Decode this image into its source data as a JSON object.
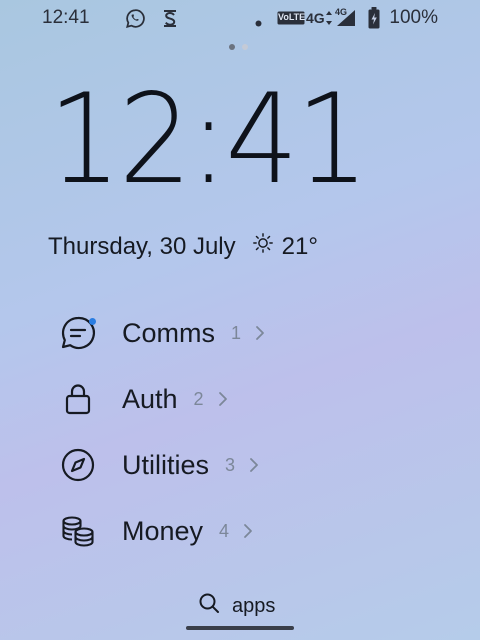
{
  "status_bar": {
    "time": "12:41",
    "network_badge": "VoLTE",
    "network_type": "4G",
    "network_type_secondary": "4G",
    "battery_percent": "100%",
    "icons": [
      "whatsapp-icon",
      "sync-icon",
      "notification-dot-icon",
      "volte-icon",
      "signal-icon",
      "battery-charging-icon"
    ]
  },
  "pager": {
    "pages": 2,
    "active_page": 1
  },
  "lock_clock": {
    "time": "12:41",
    "date": "Thursday, 30 July",
    "weather_icon": "sun-icon",
    "temperature": "21°"
  },
  "groups": [
    {
      "label": "Comms",
      "count": "1",
      "icon": "chat-bubble-icon",
      "has_notification": true
    },
    {
      "label": "Auth",
      "count": "2",
      "icon": "lock-icon",
      "has_notification": false
    },
    {
      "label": "Utilities",
      "count": "3",
      "icon": "compass-icon",
      "has_notification": false
    },
    {
      "label": "Money",
      "count": "4",
      "icon": "coins-icon",
      "has_notification": false
    }
  ],
  "search": {
    "label": "apps",
    "icon": "search-icon"
  },
  "colors": {
    "text": "#161a22",
    "muted": "#7c8799",
    "accent_dot": "#2a7de1",
    "pager_active": "#6b7380",
    "pager_inactive": "#c4cad6"
  }
}
